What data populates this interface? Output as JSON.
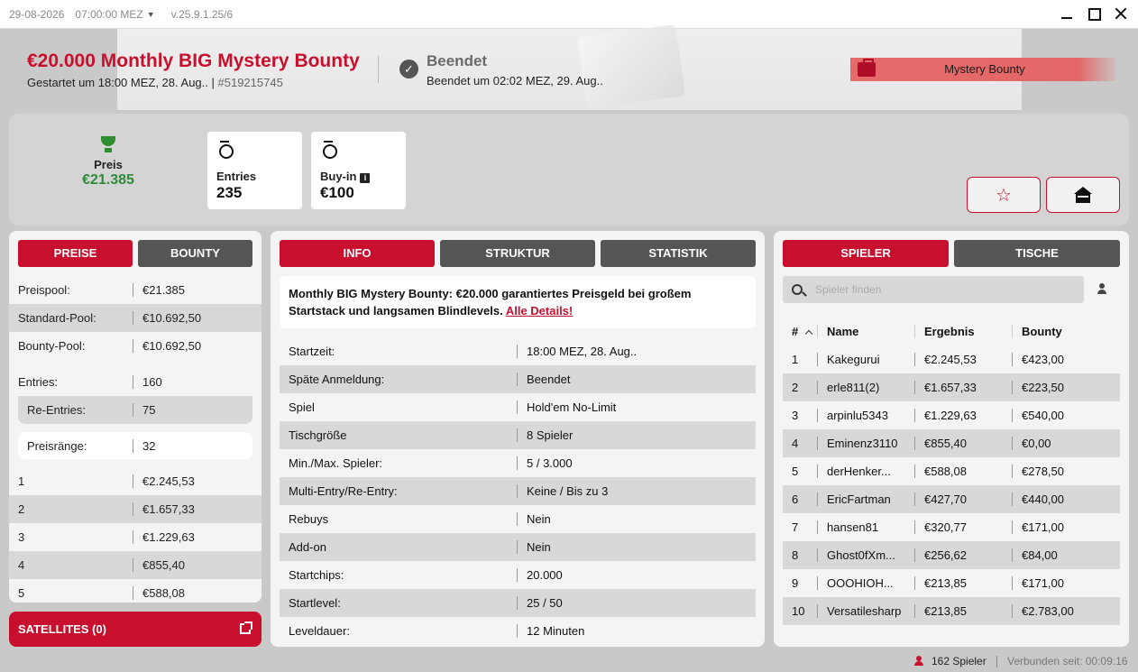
{
  "titlebar": {
    "date": "29-08-2026",
    "time": "07:00:00 MEZ",
    "version": "v.25.9.1.25/6"
  },
  "header": {
    "title": "€20.000 Monthly BIG Mystery Bounty",
    "started": "Gestartet um 18:00 MEZ, 28. Aug..",
    "id_sep": " | ",
    "id": "#519215745",
    "status_label": "Beendet",
    "status_time": "Beendet um 02:02 MEZ, 29. Aug..",
    "badge": "Mystery Bounty"
  },
  "stats": {
    "prize_label": "Preis",
    "prize_value": "€21.385",
    "entries_label": "Entries",
    "entries_value": "235",
    "buyin_label": "Buy-in",
    "buyin_value": "€100"
  },
  "left": {
    "tabs": [
      "PREISE",
      "BOUNTY"
    ],
    "pool": [
      {
        "k": "Preispool:",
        "v": "€21.385"
      },
      {
        "k": "Standard-Pool:",
        "v": "€10.692,50"
      },
      {
        "k": "Bounty-Pool:",
        "v": "€10.692,50"
      }
    ],
    "entries": [
      {
        "k": "Entries:",
        "v": "160"
      },
      {
        "k": "Re-Entries:",
        "v": "75"
      }
    ],
    "ranks": {
      "k": "Preisränge:",
      "v": "32"
    },
    "payouts": [
      {
        "k": "1",
        "v": "€2.245,53"
      },
      {
        "k": "2",
        "v": "€1.657,33"
      },
      {
        "k": "3",
        "v": "€1.229,63"
      },
      {
        "k": "4",
        "v": "€855,40"
      },
      {
        "k": "5",
        "v": "€588,08"
      }
    ],
    "satellites": "SATELLITES (0)"
  },
  "middle": {
    "tabs": [
      "INFO",
      "STRUKTUR",
      "STATISTIK"
    ],
    "desc": "Monthly BIG Mystery Bounty: €20.000 garantiertes Preisgeld bei großem Startstack und langsamen Blindlevels.",
    "desc_link": "Alle Details!",
    "rows": [
      {
        "k": "Startzeit:",
        "v": "18:00 MEZ, 28. Aug.."
      },
      {
        "k": "Späte Anmeldung:",
        "v": "Beendet"
      },
      {
        "k": "Spiel",
        "v": "Hold'em No-Limit"
      },
      {
        "k": "Tischgröße",
        "v": "8 Spieler"
      },
      {
        "k": "Min./Max. Spieler:",
        "v": "5 / 3.000"
      },
      {
        "k": "Multi-Entry/Re-Entry:",
        "v": "Keine / Bis zu 3"
      },
      {
        "k": "Rebuys",
        "v": "Nein"
      },
      {
        "k": "Add-on",
        "v": "Nein"
      },
      {
        "k": "Startchips:",
        "v": "20.000"
      },
      {
        "k": "Startlevel:",
        "v": "25 / 50"
      },
      {
        "k": "Leveldauer:",
        "v": "12 Minuten"
      }
    ]
  },
  "right": {
    "tabs": [
      "SPIELER",
      "TISCHE"
    ],
    "search_placeholder": "Spieler finden",
    "headers": {
      "rank": "#",
      "name": "Name",
      "result": "Ergebnis",
      "bounty": "Bounty"
    },
    "players": [
      {
        "rank": "1",
        "name": "Kakegurui",
        "result": "€2.245,53",
        "bounty": "€423,00"
      },
      {
        "rank": "2",
        "name": "erle811(2)",
        "result": "€1.657,33",
        "bounty": "€223,50"
      },
      {
        "rank": "3",
        "name": "arpinlu5343",
        "result": "€1.229,63",
        "bounty": "€540,00"
      },
      {
        "rank": "4",
        "name": "Eminenz3110",
        "result": "€855,40",
        "bounty": "€0,00"
      },
      {
        "rank": "5",
        "name": "derHenker...",
        "result": "€588,08",
        "bounty": "€278,50"
      },
      {
        "rank": "6",
        "name": "EricFartman",
        "result": "€427,70",
        "bounty": "€440,00"
      },
      {
        "rank": "7",
        "name": "hansen81",
        "result": "€320,77",
        "bounty": "€171,00"
      },
      {
        "rank": "8",
        "name": "Ghost0fXm...",
        "result": "€256,62",
        "bounty": "€84,00"
      },
      {
        "rank": "9",
        "name": "OOOHIOH...",
        "result": "€213,85",
        "bounty": "€171,00"
      },
      {
        "rank": "10",
        "name": "Versatilesharp",
        "result": "€213,85",
        "bounty": "€2.783,00"
      }
    ]
  },
  "statusbar": {
    "players": "162 Spieler",
    "connected": "Verbunden seit: 00:09:16"
  },
  "colors": {
    "accent": "#c8102e",
    "prize_green": "#2e8b3a",
    "tab_inactive": "#555555"
  },
  "icons": [
    "trophy-icon",
    "medal-icon",
    "info-icon",
    "star-icon",
    "home-icon",
    "check-circle-icon",
    "briefcase-icon",
    "search-icon",
    "user-icon",
    "external-link-icon",
    "sort-up-icon"
  ]
}
